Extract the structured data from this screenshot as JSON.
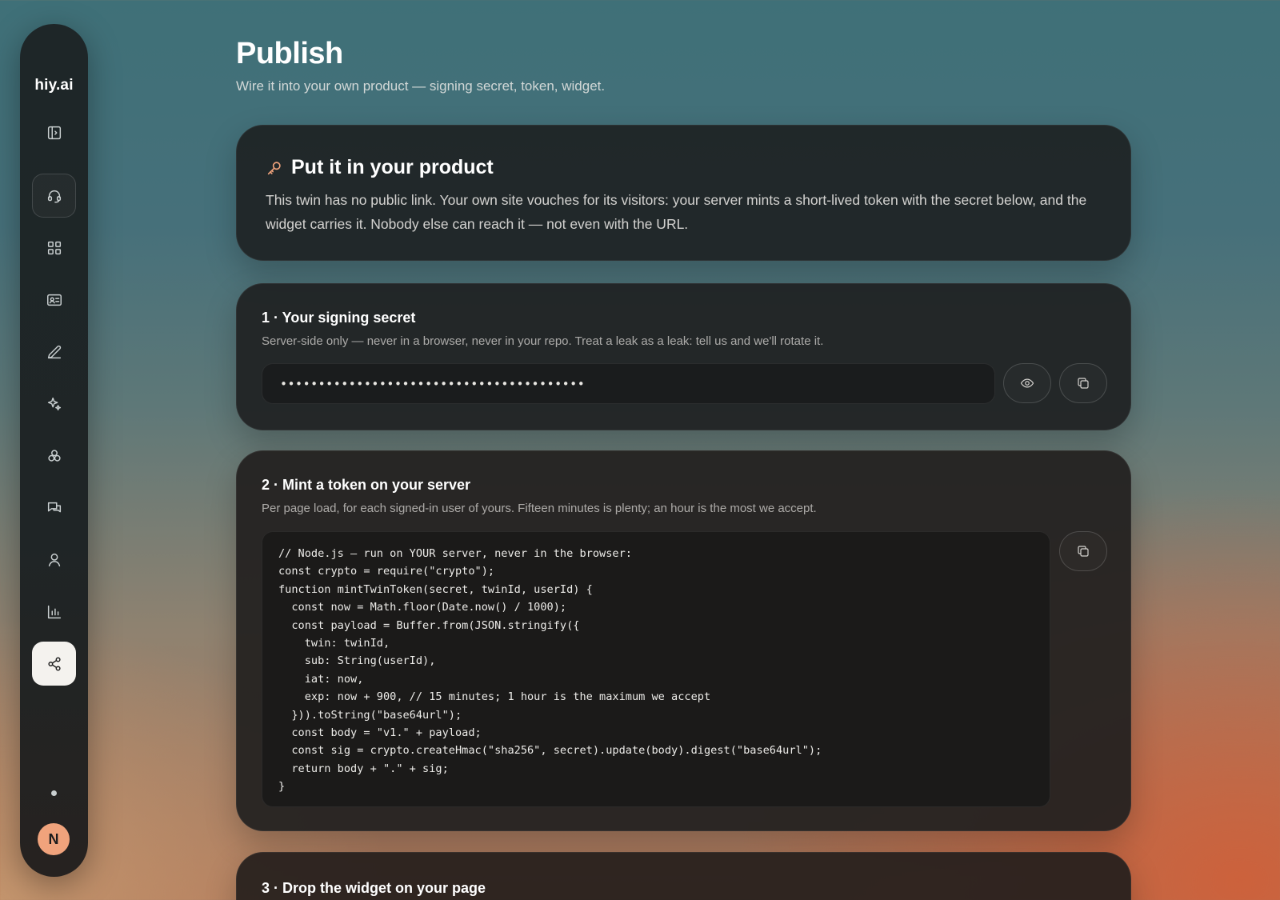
{
  "sidebar": {
    "brand": "hiy.ai",
    "items": [
      {
        "icon": "panel-toggle-icon"
      },
      {
        "icon": "headset-icon"
      },
      {
        "icon": "grid-icon"
      },
      {
        "icon": "id-card-icon"
      },
      {
        "icon": "pencil-icon"
      },
      {
        "icon": "sparkles-icon"
      },
      {
        "icon": "cluster-icon"
      },
      {
        "icon": "chat-icon"
      },
      {
        "icon": "user-icon"
      },
      {
        "icon": "bar-chart-icon"
      },
      {
        "icon": "share-icon",
        "active": true
      }
    ],
    "avatar_initial": "N"
  },
  "page": {
    "title": "Publish",
    "subtitle": "Wire it into your own product — signing secret, token, widget."
  },
  "intro": {
    "icon": "key-icon",
    "title": "Put it in your product",
    "body": "This twin has no public link. Your own site vouches for its visitors: your server mints a short-lived token with the secret below, and the widget carries it. Nobody else can reach it — not even with the URL."
  },
  "step1": {
    "title": "1 · Your signing secret",
    "description": "Server-side only — never in a browser, never in your repo. Treat a leak as a leak: tell us and we'll rotate it.",
    "secret_masked": "••••••••••••••••••••••••••••••••••••••••",
    "reveal_icon": "eye-icon",
    "copy_icon": "copy-icon"
  },
  "step2": {
    "title": "2 · Mint a token on your server",
    "description": "Per page load, for each signed-in user of yours. Fifteen minutes is plenty; an hour is the most we accept.",
    "code": "// Node.js — run on YOUR server, never in the browser:\nconst crypto = require(\"crypto\");\nfunction mintTwinToken(secret, twinId, userId) {\n  const now = Math.floor(Date.now() / 1000);\n  const payload = Buffer.from(JSON.stringify({\n    twin: twinId,\n    sub: String(userId),\n    iat: now,\n    exp: now + 900, // 15 minutes; 1 hour is the maximum we accept\n  })).toString(\"base64url\");\n  const body = \"v1.\" + payload;\n  const sig = crypto.createHmac(\"sha256\", secret).update(body).digest(\"base64url\");\n  return body + \".\" + sig;\n}",
    "copy_icon": "copy-icon"
  },
  "step3": {
    "title": "3 · Drop the widget on your page"
  }
}
